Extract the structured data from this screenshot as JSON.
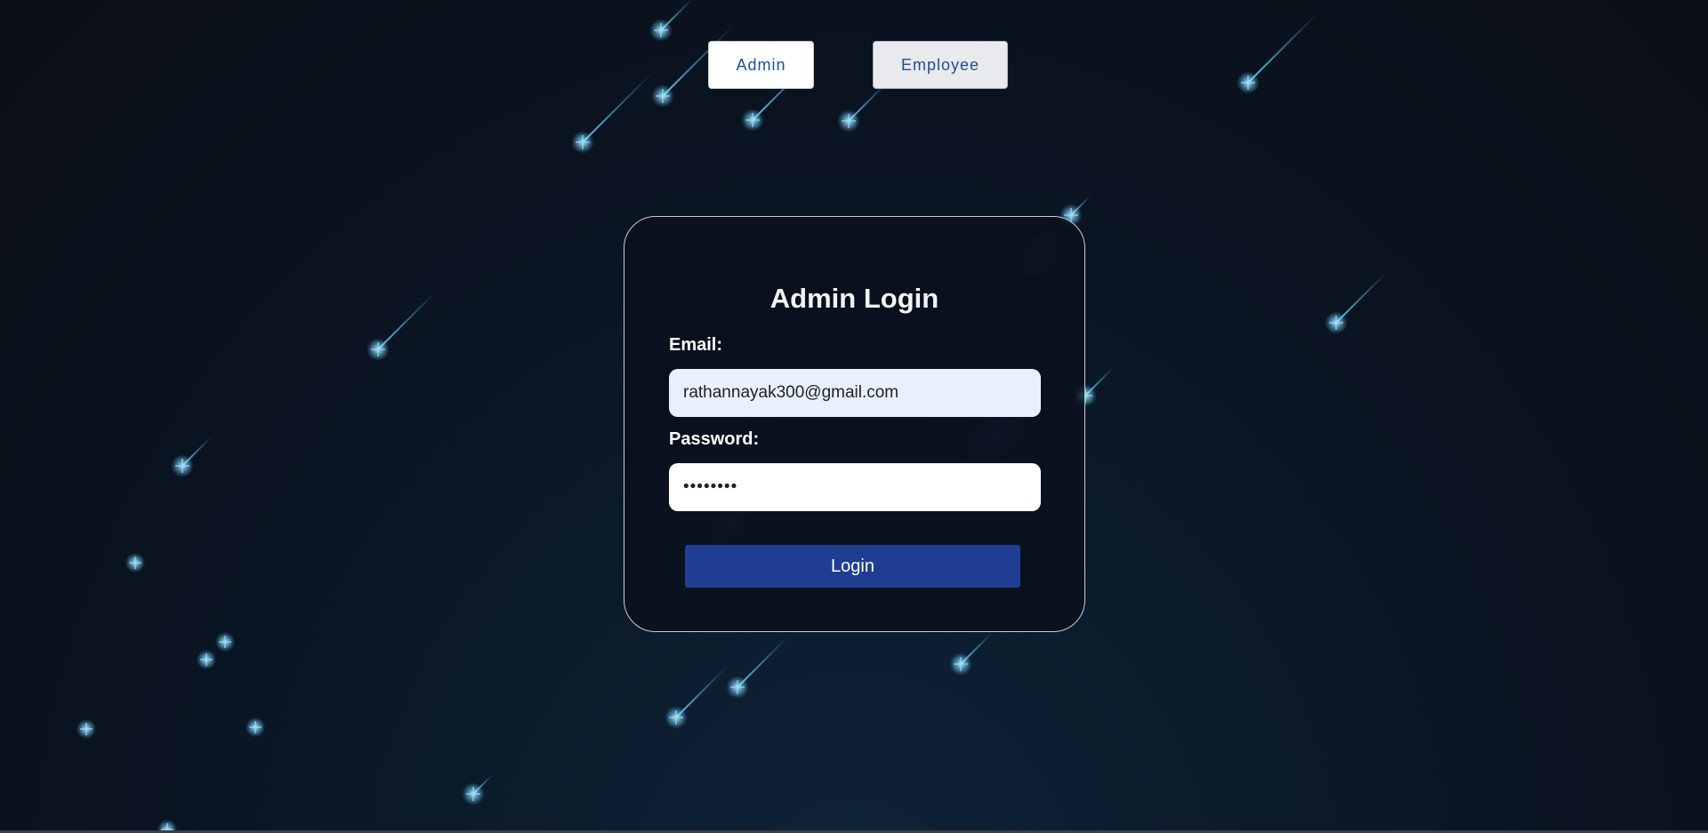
{
  "role_switch": {
    "admin_label": "Admin",
    "employee_label": "Employee"
  },
  "login_card": {
    "title": "Admin Login",
    "email_label": "Email:",
    "email_value": "rathannayak300@gmail.com",
    "password_label": "Password:",
    "password_value": "abcd1234",
    "login_button_label": "Login"
  },
  "colors": {
    "background": "#0b1320",
    "accent_button": "#1f3e92",
    "role_text": "#1e4f8f",
    "star": "#4fc3f7"
  }
}
